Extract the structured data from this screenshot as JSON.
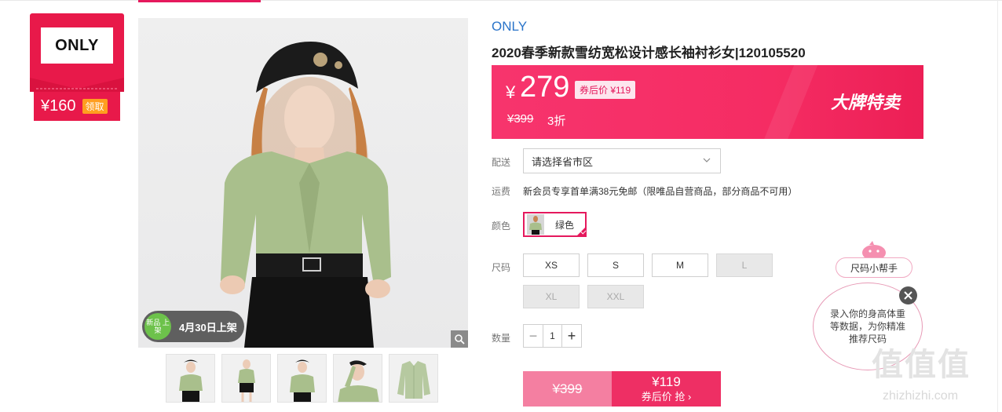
{
  "brand_card": {
    "logo_text": "ONLY",
    "coupon_amount": "¥160",
    "claim_label": "领取"
  },
  "gallery": {
    "new_badge_icon_text": "新品 上架",
    "new_badge_text": "4月30日上架",
    "thumbnail_count": 5
  },
  "product": {
    "brand": "ONLY",
    "title": "2020春季新款雪纺宽松设计感长袖衬衫女|120105520"
  },
  "price": {
    "currency": "¥",
    "current": "279",
    "coupon_price_tag": "券后价 ¥119",
    "original": "¥399",
    "discount": "3折",
    "banner_label": "大牌特卖"
  },
  "delivery": {
    "label": "配送",
    "placeholder": "请选择省市区"
  },
  "shipping": {
    "label": "运费",
    "text": "新会员专享首单满38元免邮（限唯品自营商品，部分商品不可用）"
  },
  "color": {
    "label": "颜色",
    "selected": "绿色"
  },
  "size": {
    "label": "尺码",
    "options": [
      {
        "label": "XS",
        "available": true
      },
      {
        "label": "S",
        "available": true
      },
      {
        "label": "M",
        "available": true
      },
      {
        "label": "L",
        "available": false
      },
      {
        "label": "XL",
        "available": false
      },
      {
        "label": "XXL",
        "available": false
      }
    ]
  },
  "quantity": {
    "label": "数量",
    "value": "1",
    "minus": "−",
    "plus": "+"
  },
  "buy": {
    "original_price": "¥399",
    "coupon_price": "¥119",
    "cta": "券后价 抢 ›"
  },
  "size_helper": {
    "button_label": "尺码小帮手",
    "bubble_text": "录入你的身高体重等数据，为你精准推荐尺码"
  },
  "watermark": {
    "glyphs": "值值值",
    "domain": "zhizhizhi.com"
  },
  "colors": {
    "accent": "#e5195d",
    "brand_red": "#e8194a",
    "banner_pink": "#f52c63",
    "link_blue": "#2a74c9",
    "claim_orange": "#ff9e1f"
  }
}
